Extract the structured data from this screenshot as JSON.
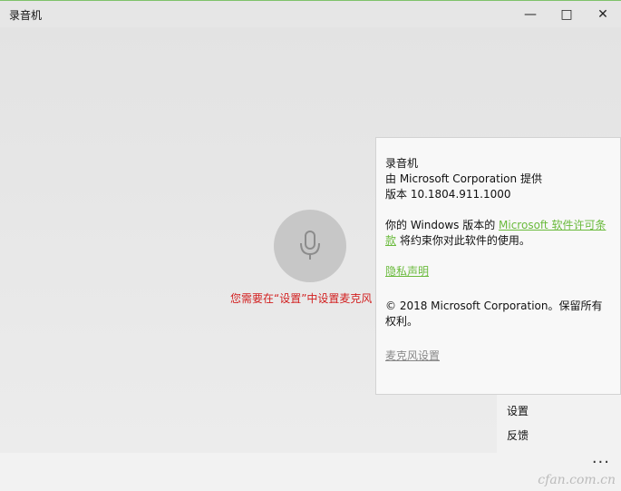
{
  "window": {
    "title": "录音机",
    "minimize": "—",
    "maximize": "□",
    "close": "✕"
  },
  "main": {
    "mic_icon": "microphone-icon",
    "error_message": "您需要在“设置”中设置麦克风"
  },
  "about": {
    "app_name": "录音机",
    "publisher": "由 Microsoft Corporation 提供",
    "version": "版本 10.1804.911.1000",
    "license_pre": "你的 Windows 版本的 ",
    "license_link": "Microsoft 软件许可条款",
    "license_post": " 将约束你对此软件的使用。",
    "privacy_link": "隐私声明",
    "copyright": "© 2018 Microsoft Corporation。保留所有权利。",
    "mic_settings_link": "麦克风设置"
  },
  "menu": {
    "items": [
      "设置",
      "反馈"
    ]
  },
  "bottom": {
    "more": "···",
    "watermark": "cfan.com.cn"
  },
  "colors": {
    "accent_link": "#6aba3c",
    "error": "#d21f1f",
    "title_border": "#7fc26b"
  }
}
